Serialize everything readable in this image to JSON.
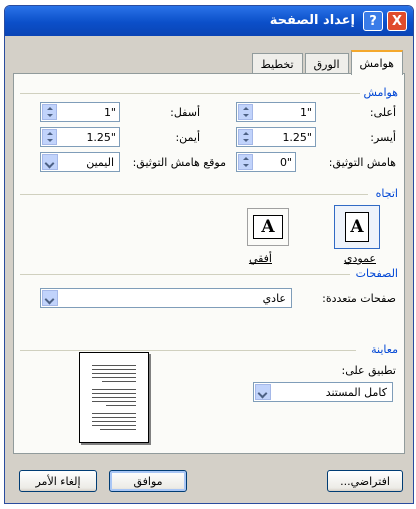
{
  "window": {
    "title": "إعداد الصفحة",
    "help": "?",
    "close": "X"
  },
  "tabs": [
    {
      "label": "هوامش"
    },
    {
      "label": "الورق"
    },
    {
      "label": "تخطيط"
    }
  ],
  "margins": {
    "section": "هوامش",
    "top_label": "أعلى:",
    "top_value": "1\"",
    "bottom_label": "أسفل:",
    "bottom_value": "1\"",
    "left_label": "أيسر:",
    "left_value": "1.25\"",
    "right_label": "أيمن:",
    "right_value": "1.25\"",
    "gutter_label": "هامش التوثيق:",
    "gutter_value": "0\"",
    "gutter_pos_label": "موقع هامش التوثيق:",
    "gutter_pos_value": "اليمين"
  },
  "orientation": {
    "section": "اتجاه",
    "portrait": "عمودي",
    "landscape": "أفقي",
    "glyph": "A"
  },
  "pages": {
    "section": "الصفحات",
    "multiple_label": "صفحات متعددة:",
    "multiple_value": "عادي"
  },
  "preview": {
    "section": "معاينة",
    "apply_label": "تطبيق على:",
    "apply_value": "كامل المستند"
  },
  "buttons": {
    "default": "افتراضي...",
    "ok": "موافق",
    "cancel": "إلغاء الأمر"
  }
}
